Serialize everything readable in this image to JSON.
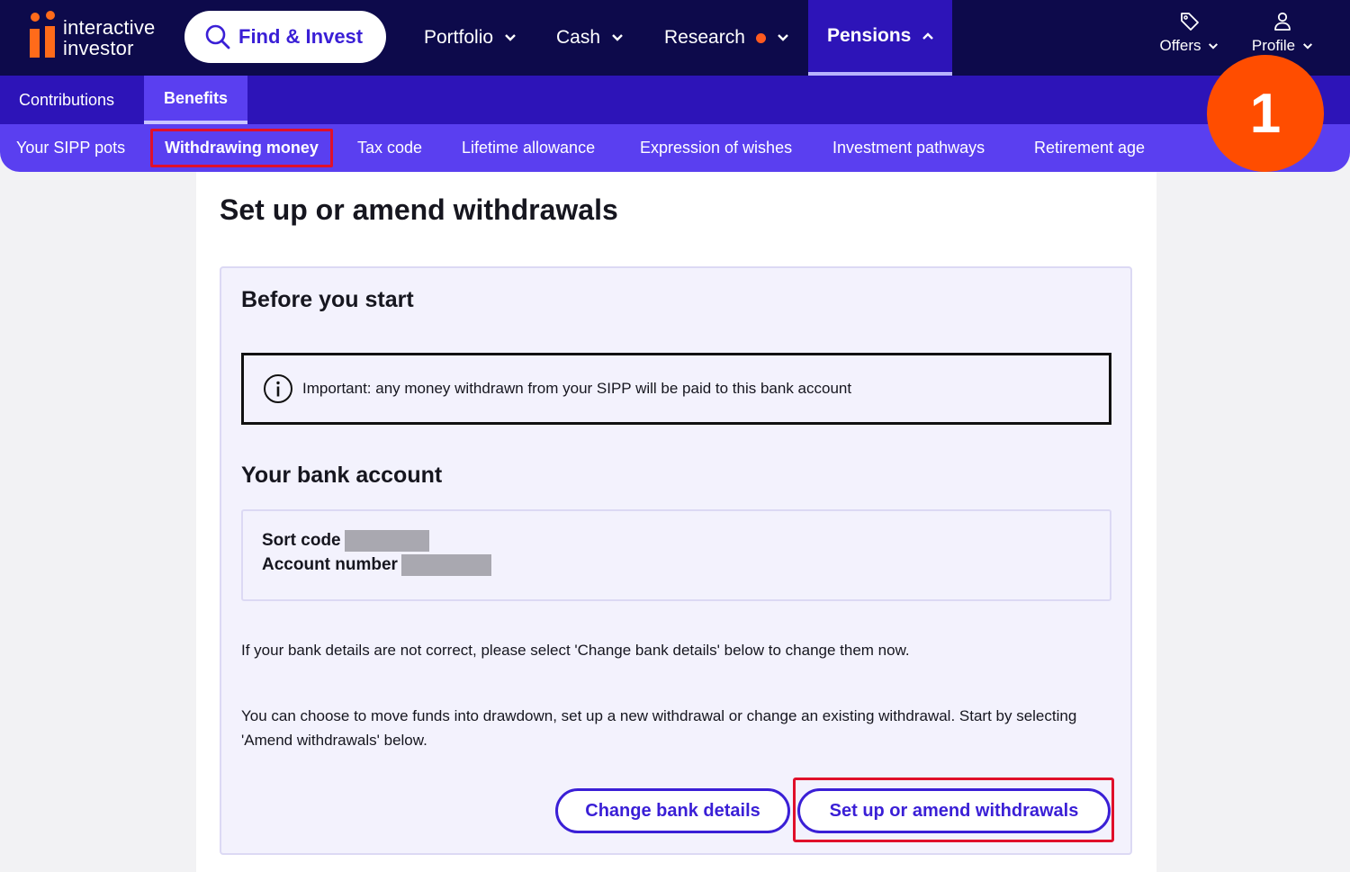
{
  "brand": {
    "line1": "interactive",
    "line2": "investor"
  },
  "topnav": {
    "find_invest": "Find & Invest",
    "portfolio": "Portfolio",
    "cash": "Cash",
    "research": "Research",
    "pensions": "Pensions",
    "offers": "Offers",
    "profile": "Profile"
  },
  "subnav1": {
    "contributions": "Contributions",
    "benefits": "Benefits"
  },
  "subnav2": [
    "Your SIPP pots",
    "Withdrawing money",
    "Tax code",
    "Lifetime allowance",
    "Expression of wishes",
    "Investment pathways",
    "Retirement age"
  ],
  "step_badge": "1",
  "page": {
    "title": "Set up or amend withdrawals",
    "before_heading": "Before you start",
    "notice": "Important: any money withdrawn from your SIPP will be paid to this bank account",
    "bank_heading": "Your bank account",
    "sort_code_label": "Sort code",
    "account_number_label": "Account number",
    "para1": "If your bank details are not correct, please select 'Change bank details' below to change them now.",
    "para2": "You can choose to move funds into drawdown, set up a new withdrawal or change an existing withdrawal. Start by selecting 'Amend withdrawals' below.",
    "change_bank_button": "Change bank details",
    "amend_button": "Set up or amend withdrawals"
  },
  "colors": {
    "nav_dark": "#0d0a4b",
    "nav_mid": "#2d14b8",
    "nav_light": "#5a3ff0",
    "accent_orange": "#ff4d00",
    "highlight_red": "#e0102a",
    "link_blue": "#3a1fd6"
  },
  "icons": [
    "logo-mark",
    "search-icon",
    "chevron-down-icon",
    "chevron-up-icon",
    "tag-icon",
    "user-icon",
    "info-icon"
  ]
}
